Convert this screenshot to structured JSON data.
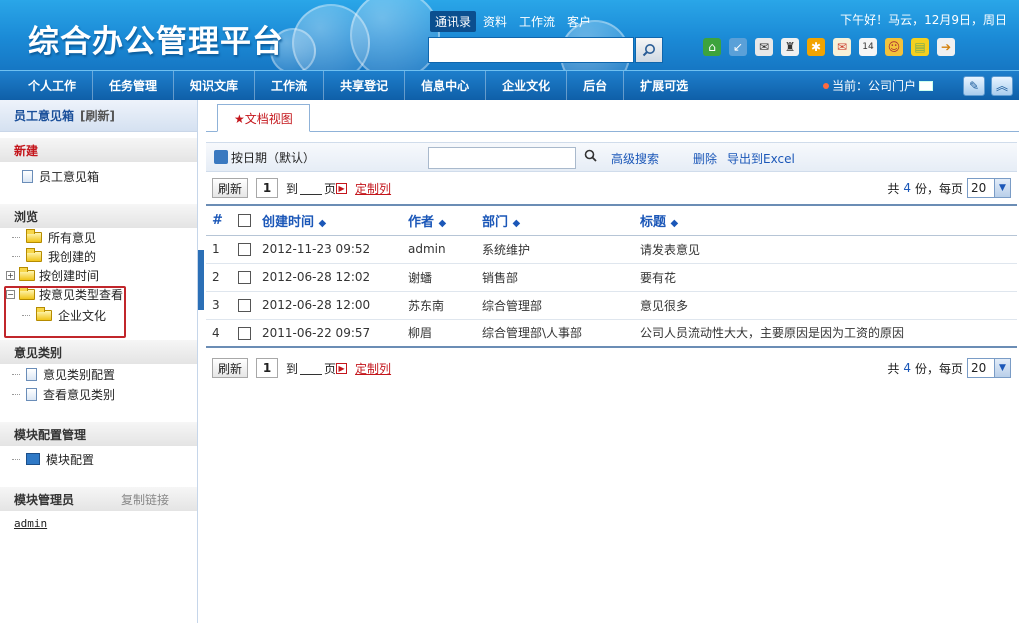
{
  "header": {
    "logo": "综合办公管理平台",
    "top_tabs": [
      "通讯录",
      "资料",
      "工作流",
      "客户"
    ],
    "greeting": "下午好！马云，12月9日，周日",
    "search": {
      "value": "",
      "placeholder": ""
    }
  },
  "nav": {
    "items": [
      "个人工作",
      "任务管理",
      "知识文库",
      "工作流",
      "共享登记",
      "信息中心",
      "企业文化",
      "后台",
      "扩展可选"
    ],
    "current": "当前：公司门户"
  },
  "sidebar": {
    "title": "员工意见箱",
    "refresh": "[刷新]",
    "new_section": {
      "head": "新建",
      "items": [
        "员工意见箱"
      ]
    },
    "browse_section": {
      "head": "浏览",
      "items": [
        "所有意见",
        "我创建的",
        "按创建时间",
        "按意见类型查看"
      ],
      "subitems": [
        "企业文化"
      ]
    },
    "category_section": {
      "head": "意见类别",
      "items": [
        "意见类别配置",
        "查看意见类别"
      ]
    },
    "module_section": {
      "head": "模块配置管理",
      "items": [
        "模块配置"
      ]
    },
    "admin_section": {
      "head": "模块管理员",
      "link": "复制链接",
      "user": "admin"
    }
  },
  "main": {
    "tab_label": "★文档视图",
    "toolbar": {
      "date_label": "按日期（默认）",
      "search_value": "",
      "advanced_search": "高级搜索",
      "delete": "删除",
      "export": "导出到Excel"
    },
    "pager": {
      "refresh": "刷新",
      "page": "1",
      "to": "到",
      "page_unit": "页",
      "custom_columns": "定制列",
      "total_prefix": "共",
      "total": "4",
      "total_suffix": "份，每页",
      "per_page": "20"
    },
    "table": {
      "headers": [
        "#",
        "创建时间",
        "作者",
        "部门",
        "标题"
      ],
      "rows": [
        {
          "num": "1",
          "time": "2012-11-23 09:52",
          "author": "admin",
          "dept": "系统维护",
          "title": "请发表意见"
        },
        {
          "num": "2",
          "time": "2012-06-28 12:02",
          "author": "谢蟠",
          "dept": "销售部",
          "title": "要有花"
        },
        {
          "num": "3",
          "time": "2012-06-28 12:00",
          "author": "苏东南",
          "dept": "综合管理部",
          "title": "意见很多"
        },
        {
          "num": "4",
          "time": "2011-06-22 09:57",
          "author": "柳眉",
          "dept": "综合管理部\\人事部",
          "title": "公司人员流动性大大，主要原因是因为工资的原因"
        }
      ]
    }
  },
  "colors": {
    "header_blue": "#1b8ad6",
    "nav_blue": "#0f5fa8",
    "link_blue": "#1b57b8",
    "accent_red": "#c4161c"
  },
  "icons": [
    "home-icon",
    "arrows-icon",
    "mail-icon",
    "shirt-icon",
    "gear-icon",
    "envelope-icon",
    "calendar-icon",
    "user-icon",
    "note-icon",
    "exit-icon"
  ]
}
